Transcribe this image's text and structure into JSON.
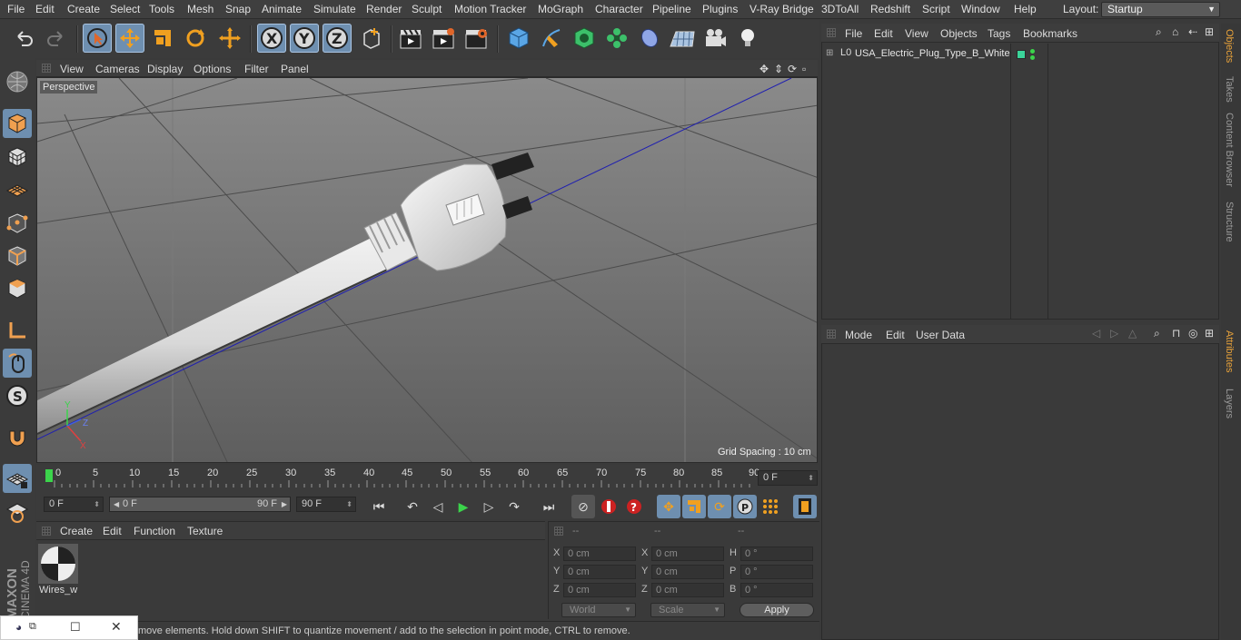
{
  "menubar": {
    "items": [
      "File",
      "Edit",
      "Create",
      "Select",
      "Tools",
      "Mesh",
      "Snap",
      "Animate",
      "Simulate",
      "Render",
      "Sculpt",
      "Motion Tracker",
      "MoGraph",
      "Character",
      "Pipeline",
      "Plugins",
      "V-Ray Bridge",
      "3DToAll",
      "Redshift",
      "Script",
      "Window",
      "Help"
    ],
    "layout_label": "Layout:",
    "layout_value": "Startup"
  },
  "viewport": {
    "menu": [
      "View",
      "Cameras",
      "Display",
      "Options",
      "Filter",
      "Panel"
    ],
    "camera_label": "Perspective",
    "grid_spacing": "Grid Spacing : 10 cm",
    "axis_y": "Y",
    "axis_z": "Z",
    "axis_x": "X"
  },
  "timeline": {
    "ticks": [
      "0",
      "5",
      "10",
      "15",
      "20",
      "25",
      "30",
      "35",
      "40",
      "45",
      "50",
      "55",
      "60",
      "65",
      "70",
      "75",
      "80",
      "85",
      "90"
    ],
    "current_frame": "0 F"
  },
  "transport": {
    "start_frame": "0 F",
    "range_start": "0 F",
    "range_end": "90 F",
    "end_frame": "90 F"
  },
  "material": {
    "menu": [
      "Create",
      "Edit",
      "Function",
      "Texture"
    ],
    "thumb_label": "Wires_w"
  },
  "coords": {
    "headers": [
      "--",
      "--",
      "--"
    ],
    "rows": [
      {
        "l1": "X",
        "v1": "0 cm",
        "l2": "X",
        "v2": "0 cm",
        "l3": "H",
        "v3": "0 °"
      },
      {
        "l1": "Y",
        "v1": "0 cm",
        "l2": "Y",
        "v2": "0 cm",
        "l3": "P",
        "v3": "0 °"
      },
      {
        "l1": "Z",
        "v1": "0 cm",
        "l2": "Z",
        "v2": "0 cm",
        "l3": "B",
        "v3": "0 °"
      }
    ],
    "world": "World",
    "scale": "Scale",
    "apply": "Apply"
  },
  "status": {
    "text": "move elements. Hold down SHIFT to quantize movement / add to the selection in point mode, CTRL to remove."
  },
  "objects": {
    "menu": [
      "File",
      "Edit",
      "View",
      "Objects",
      "Tags",
      "Bookmarks"
    ],
    "items": [
      {
        "name": "USA_Electric_Plug_Type_B_White"
      }
    ]
  },
  "attributes": {
    "menu": [
      "Mode",
      "Edit",
      "User Data"
    ]
  },
  "right_tabs": [
    "Objects",
    "Takes",
    "Content Browser",
    "Structure",
    "Attributes",
    "Layers"
  ],
  "brand": {
    "line1": "MAXON",
    "line2": "CINEMA 4D"
  },
  "colors": {
    "accent": "#6e8fb0",
    "tab_active": "#e8a23a",
    "play": "#3bd44b"
  }
}
